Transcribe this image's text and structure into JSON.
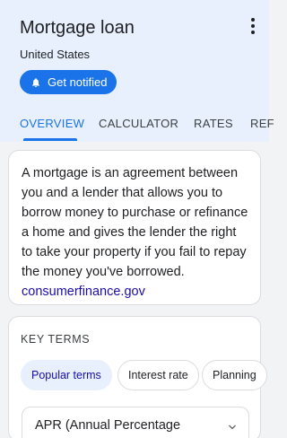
{
  "header": {
    "title": "Mortgage loan",
    "subtitle": "United States",
    "notify_label": "Get notified",
    "notify_icon": "bell-icon",
    "menu_icon": "more-vert-icon"
  },
  "tabs": [
    {
      "label": "OVERVIEW",
      "active": true
    },
    {
      "label": "CALCULATOR",
      "active": false
    },
    {
      "label": "RATES",
      "active": false
    },
    {
      "label": "REF",
      "active": false
    }
  ],
  "description": {
    "text": "A mortgage is an agreement between you and a lender that allows you to borrow money to purchase or refinance a home and gives the lender the right to take your property if you fail to repay the money you've borrowed.",
    "link_text": "consumerfinance.gov"
  },
  "key_terms": {
    "heading": "KEY TERMS",
    "chips": [
      "Popular terms",
      "Interest rate",
      "Planning"
    ],
    "selected_chip": "Popular terms",
    "first_term": "APR (Annual Percentage",
    "expand_icon": "chevron-down-icon"
  },
  "colors": {
    "accent": "#1a73e8",
    "header_bg": "#e8f0fe",
    "link": "#1a0dab"
  }
}
